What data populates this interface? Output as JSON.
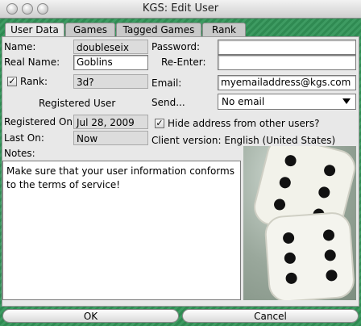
{
  "window": {
    "title": "KGS: Edit User"
  },
  "tabs": [
    {
      "label": "User Data",
      "active": true
    },
    {
      "label": "Games",
      "active": false
    },
    {
      "label": "Tagged Games",
      "active": false
    },
    {
      "label": "Rank",
      "active": false
    }
  ],
  "form": {
    "name_label": "Name:",
    "name_value": "doubleseix",
    "real_name_label": "Real Name:",
    "real_name_value": "Goblins",
    "rank_label": "Rank:",
    "rank_checked": true,
    "rank_value": "3d?",
    "registered_user_text": "Registered User",
    "registered_on_label": "Registered On:",
    "registered_on_value": "Jul 28, 2009",
    "last_on_label": "Last On:",
    "last_on_value": "Now",
    "notes_label": "Notes:",
    "notes_value": "Make sure that your user information conforms\nto the terms of service!",
    "password_label": "Password:",
    "password_value": "",
    "reenter_label": "Re-Enter:",
    "reenter_value": "",
    "email_label": "Email:",
    "email_value": "myemailaddress@kgs.com",
    "send_label": "Send...",
    "send_selected": "No email",
    "hide_address_label": "Hide address from other users?",
    "hide_address_checked": true,
    "client_version_text": "Client version: English (United States)"
  },
  "buttons": {
    "ok": "OK",
    "cancel": "Cancel"
  }
}
